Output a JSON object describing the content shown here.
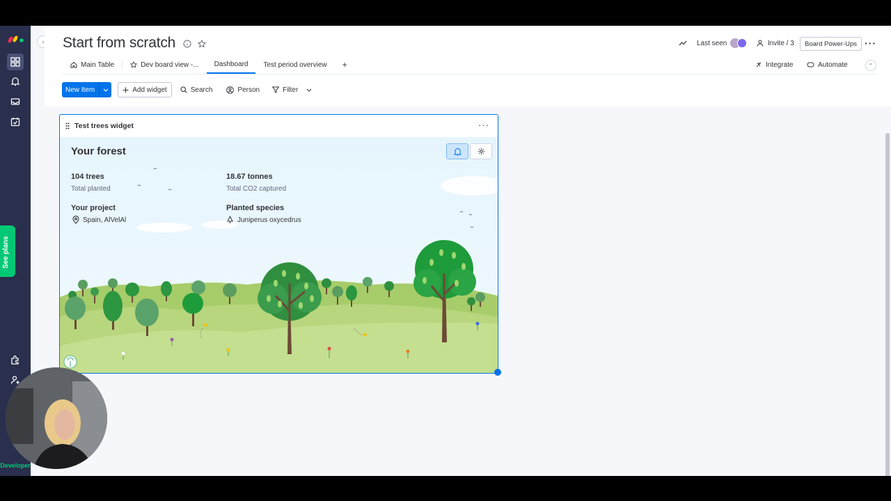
{
  "board": {
    "title": "Start from scratch",
    "last_seen_label": "Last seen",
    "invite_label": "Invite / 3",
    "power_ups_label": "Board Power-Ups",
    "integrate_label": "Integrate",
    "automate_label": "Automate"
  },
  "tabs": [
    {
      "label": "Main Table",
      "icon": "home-icon"
    },
    {
      "label": "Dev board view -...",
      "icon": "star-icon"
    },
    {
      "label": "Dashboard",
      "active": true
    },
    {
      "label": "Test period overview"
    },
    {
      "label": "+"
    }
  ],
  "toolbar": {
    "new_item": "New Item",
    "add_widget": "Add widget",
    "search": "Search",
    "person": "Person",
    "filter": "Filter"
  },
  "sidebar": {
    "see_plans": "See plans",
    "developer_label": "Developer"
  },
  "widget": {
    "title": "Test trees widget",
    "more": "···",
    "forest_title": "Your forest",
    "trees_value": "104 trees",
    "trees_label": "Total planted",
    "co2_value": "18.67 tonnes",
    "co2_label": "Total CO2 captured",
    "project_label": "Your project",
    "project_value": "Spain, AlVelAl",
    "species_label": "Planted species",
    "species_value": "Juniperus oxycedrus"
  },
  "colors": {
    "primary": "#0073ea",
    "sidebar_bg": "#292f4c",
    "green_badge": "#00c875",
    "sky": "#e5f5fd",
    "grass": "#c4df8f"
  }
}
